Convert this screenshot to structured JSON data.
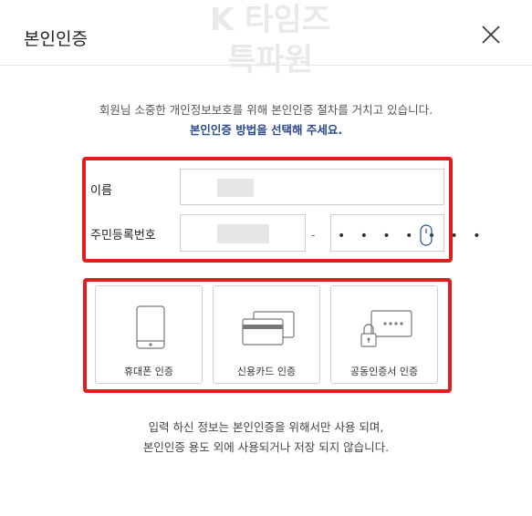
{
  "header": {
    "title": "본인인증",
    "close_icon": "close-icon"
  },
  "watermark": {
    "line1": "K 타임즈",
    "line2": "특파원"
  },
  "intro": {
    "line1": "회원님 소중한 개인정보보호를 위해 본인인증 절차를 거치고 있습니다.",
    "line2": "본인인증 방법을 선택해 주세요.",
    "accent_color": "#2b4a91"
  },
  "form": {
    "name_label": "이름",
    "rrn_label": "주민등록번호",
    "rrn_separator": "-",
    "rrn_back_masked": "• • • • • • •",
    "mouse_icon": "mouse-icon"
  },
  "methods": [
    {
      "label": "휴대폰 인증",
      "icon": "phone-icon"
    },
    {
      "label": "신용카드 인증",
      "icon": "credit-card-icon"
    },
    {
      "label": "공동인증서 인증",
      "icon": "certificate-icon"
    }
  ],
  "notice": {
    "line1": "입력 하신 정보는 본인인증을 위해서만 사용 되며,",
    "line2": "본인인증 용도 외에 사용되거나 저장 되지 않습니다."
  },
  "highlight_color": "#e01e1e"
}
